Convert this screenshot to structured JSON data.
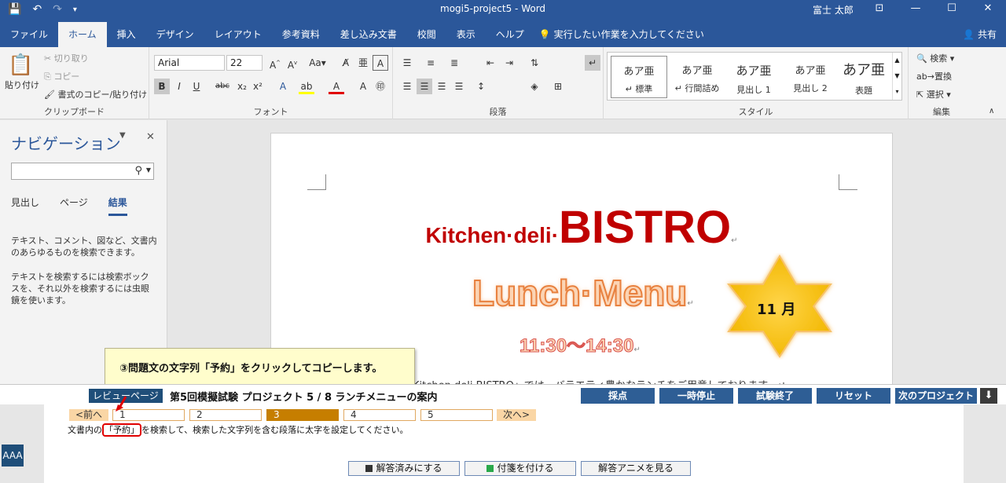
{
  "titlebar": {
    "title": "mogi5-project5  -  Word",
    "user": "富士 太郎",
    "qat": [
      "💾",
      "↶",
      "↷",
      "▾"
    ]
  },
  "tabs": [
    "ファイル",
    "ホーム",
    "挿入",
    "デザイン",
    "レイアウト",
    "参考資料",
    "差し込み文書",
    "校閲",
    "表示",
    "ヘルプ"
  ],
  "tell_me": "実行したい作業を入力してください",
  "share": "共有",
  "ribbon": {
    "clipboard": {
      "paste": "貼り付け",
      "cut": "切り取り",
      "copy": "コピー",
      "format_painter": "書式のコピー/貼り付け",
      "label": "クリップボード"
    },
    "font": {
      "name": "Arial",
      "size": "22",
      "label": "フォント"
    },
    "paragraph": {
      "label": "段落"
    },
    "styles": {
      "label": "スタイル",
      "items": [
        {
          "sample": "あア亜",
          "name": "↵ 標準"
        },
        {
          "sample": "あア亜",
          "name": "↵ 行間詰め"
        },
        {
          "sample": "あア亜",
          "name": "見出し 1"
        },
        {
          "sample": "あア亜",
          "name": "見出し 2"
        },
        {
          "sample": "あア亜",
          "name": "表題"
        }
      ]
    },
    "editing": {
      "find": "検索",
      "replace": "置換",
      "select": "選択",
      "label": "編集"
    }
  },
  "nav": {
    "title": "ナビゲーション",
    "tabs": [
      "見出し",
      "ページ",
      "結果"
    ],
    "text1": "テキスト、コメント、図など、文書内のあらゆるものを検索できます。",
    "text2": "テキストを検索するには検索ボックスを、それ以外を検索するには虫眼鏡を使います。"
  },
  "document": {
    "line1_small": "Kitchen·deli·",
    "line1_big": "BISTRO",
    "lunch": "Lunch·Menu",
    "time": "11:30〜14:30",
    "star": "11 月",
    "body": "Kitchen·deli·BISTRO」では、バラエティ豊かなランチをご用意しております。↵",
    "mark": "↵"
  },
  "callout": "③問題文の文字列「予約」をクリックしてコピーします。",
  "exam": {
    "review": "レビューページ",
    "title": "第5回模擬試験 プロジェクト 5 / 8 ランチメニューの案内",
    "buttons": [
      "採点",
      "一時停止",
      "試験終了",
      "リセット",
      "次のプロジェクト"
    ],
    "download_icon": "⬇"
  },
  "task": {
    "prev": "<前へ",
    "next": "次へ>",
    "pages": [
      "1",
      "2",
      "3",
      "4",
      "5"
    ],
    "text_before": "文書内の",
    "text_hl": "「予約」",
    "text_after": "を検索して、検索した文字列を含む段落に太字を設定してください。",
    "buttons": [
      "解答済みにする",
      "付箋を付ける",
      "解答アニメを見る"
    ],
    "font_size_btn": "AAA"
  }
}
